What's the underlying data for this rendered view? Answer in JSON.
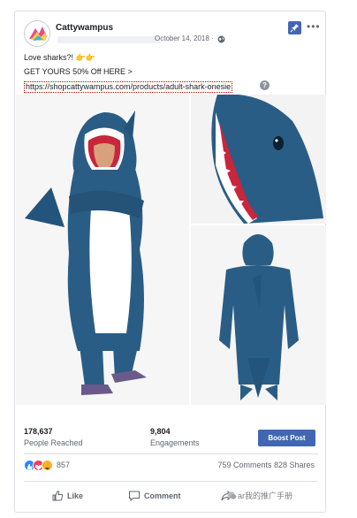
{
  "post": {
    "page_name": "Cattywampus",
    "date": "October 14, 2018 ·",
    "line1": "Love sharks?! 👉👉",
    "line2": "GET YOURS 50% Off HERE >",
    "link": "https://shopcattywampus.com/products/adult-shark-onesie",
    "help_icon_glyph": "?"
  },
  "insights": {
    "reach_value": "178,637",
    "reach_label": "People Reached",
    "engagement_value": "9,804",
    "engagement_label": "Engagements",
    "boost_label": "Boost Post"
  },
  "social": {
    "reaction_count": "857",
    "counts": "759 Comments  828 Shares"
  },
  "actions": {
    "like_label": "Like",
    "comment_label": "Comment",
    "share_label": "Share"
  },
  "watermark": {
    "text": "ar我的推广手册"
  },
  "colors": {
    "shark_blue": "#2a5d86",
    "accent": "#4267b2"
  },
  "icons": [
    "globe-icon",
    "pin-icon",
    "more-icon",
    "help-icon",
    "like-icon",
    "comment-icon",
    "share-icon",
    "wechat-icon"
  ]
}
